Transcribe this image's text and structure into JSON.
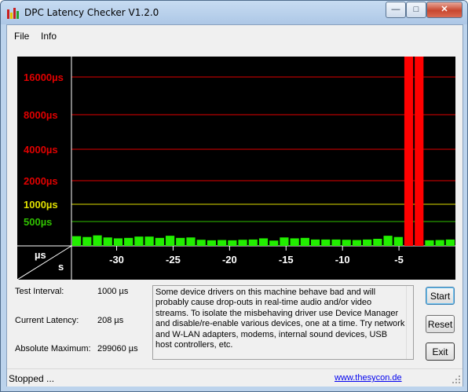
{
  "window": {
    "title": "DPC Latency Checker V1.2.0",
    "minimize_glyph": "—",
    "maximize_glyph": "□",
    "close_glyph": "✕"
  },
  "menu": {
    "items": [
      "File",
      "Info"
    ]
  },
  "chart_data": {
    "type": "bar",
    "y_axis_unit_label": "µs",
    "x_axis_unit_label": "s",
    "y_gridlines": [
      {
        "label": "16000µs",
        "value": 16000,
        "color": "#e00000"
      },
      {
        "label": "8000µs",
        "value": 8000,
        "color": "#e00000"
      },
      {
        "label": "4000µs",
        "value": 4000,
        "color": "#e00000"
      },
      {
        "label": "2000µs",
        "value": 2000,
        "color": "#e00000"
      },
      {
        "label": "1000µs",
        "value": 1000,
        "color": "#e0e000"
      },
      {
        "label": "500µs",
        "value": 500,
        "color": "#30c000"
      }
    ],
    "x_ticks": [
      "-30",
      "-25",
      "-20",
      "-15",
      "-10",
      "-5"
    ],
    "x_range": [
      -34,
      0
    ],
    "bar_values": [
      230,
      220,
      240,
      215,
      205,
      210,
      225,
      225,
      210,
      235,
      210,
      215,
      180,
      170,
      175,
      170,
      180,
      185,
      205,
      165,
      215,
      205,
      210,
      185,
      185,
      185,
      180,
      175,
      185,
      200,
      235,
      220,
      299060,
      299060,
      170,
      175,
      185
    ],
    "colors": {
      "ok": "#22ee00",
      "bad": "#ff0000",
      "background": "#000000",
      "ylabel_red": "#e00000",
      "ylabel_yellow": "#e0e000",
      "ylabel_green": "#20c000"
    }
  },
  "info": {
    "test_interval_label": "Test Interval:",
    "test_interval_value": "1000 µs",
    "current_latency_label": "Current Latency:",
    "current_latency_value": "208 µs",
    "absolute_maximum_label": "Absolute Maximum:",
    "absolute_maximum_value": "299060 µs"
  },
  "description": "Some device drivers on this machine behave bad and will probably cause drop-outs in real-time audio and/or video streams. To isolate the misbehaving driver use Device Manager and disable/re-enable various devices, one at a time. Try network and W-LAN adapters, modems, internal sound devices, USB host controllers, etc.",
  "buttons": {
    "start": "Start",
    "reset": "Reset",
    "exit": "Exit"
  },
  "status": {
    "text": "Stopped ...",
    "link": "www.thesycon.de"
  }
}
